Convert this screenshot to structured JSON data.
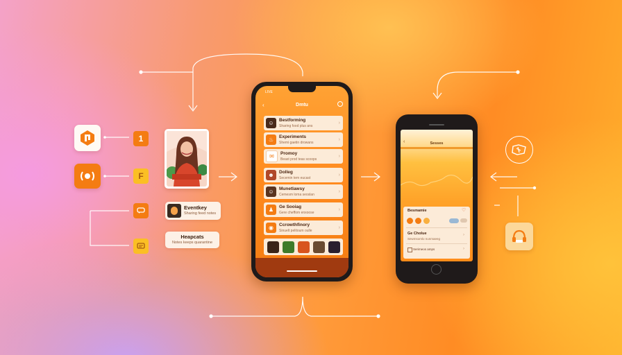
{
  "left_column": {
    "tile1_label": "1",
    "tile2_label": "F",
    "card1_title": "Eventkey",
    "card1_sub": "Sharing feed notes",
    "card2_title": "Heapcats",
    "card2_sub": "Notes keeps quarantine"
  },
  "phone_left": {
    "status_left": "LIVE",
    "title": "Dmtu",
    "rows": [
      {
        "title": "Bestforming",
        "sub": "Sharing food plus ans"
      },
      {
        "title": "Experiments",
        "sub": "Shemi gaetin drowans"
      },
      {
        "title": "Promoy",
        "sub": "Beast prod teas scoops"
      },
      {
        "title": "Dolleg",
        "sub": "Secemin tem eucast"
      },
      {
        "title": "Munetlawsy",
        "sub": "Cemesm loma seoslan"
      },
      {
        "title": "Ge Sooiag",
        "sub": "Gere cheffom enxoose"
      },
      {
        "title": "Ccrowthfinory",
        "sub": "Sinuelt pelitoum oulle"
      }
    ]
  },
  "phone_right": {
    "title": "Sesses",
    "panel_title": "Besmamie",
    "row2_title": "Ge Cholue",
    "row2_sub": "Sewmsomlo nunmaeeg",
    "row3_title": "Serimeos amps"
  },
  "colors": {
    "orange": "#f47c12",
    "orange_light": "#ffa234",
    "yellow": "#fbbf24",
    "phone_body": "#1f1a1a"
  }
}
